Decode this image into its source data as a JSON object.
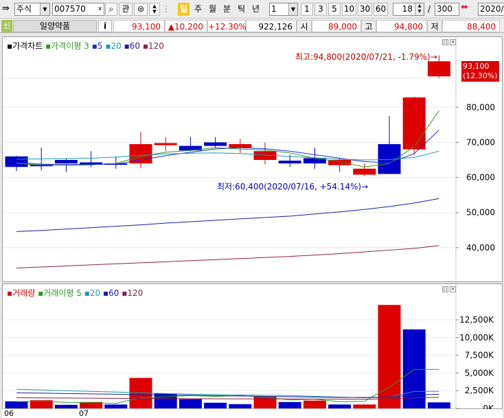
{
  "toolbar": {
    "market": "주식",
    "code": "007570",
    "watch_label": "관",
    "period_buttons": [
      "일",
      "주",
      "월",
      "분",
      "틱",
      "년"
    ],
    "interval_select": "1",
    "interval_buttons": [
      "1",
      "3",
      "5",
      "10",
      "30",
      "60"
    ],
    "page_current": "18",
    "page_sep": "/",
    "page_total": "300",
    "date": "2020/0"
  },
  "quote": {
    "badge": "신",
    "name": "일양약품",
    "info": "i",
    "price": "93,100",
    "change": "▲10,200",
    "change_pct": "+12.30%",
    "volume": "922,126",
    "open_label": "시",
    "open": "89,000",
    "high_label": "고",
    "high": "94,800",
    "low_label": "저",
    "low": "88,400"
  },
  "colors": {
    "up": "#dd0000",
    "down": "#0000c8",
    "ma_short": "#2e9a1e",
    "ma5": "#1a2ed6",
    "ma20": "#1f9ab0",
    "ma60": "#1c1ca8",
    "ma120": "#8a1f48"
  },
  "price_panel": {
    "legend_title": "가격차트",
    "legend_ma": "가격이평",
    "legend_periods": [
      "3",
      "5",
      "20",
      "60",
      "120"
    ],
    "high_note": "최고:94,800(2020/07/21, -1.79%)→",
    "low_note": "최저:60,400(2020/07/16, +54.14%)→",
    "current_price": "93,100",
    "current_pct": "(12.30%)"
  },
  "volume_panel": {
    "legend_title": "거래량",
    "legend_ma": "거래이평",
    "legend_periods": [
      "5",
      "20",
      "60",
      "120"
    ]
  },
  "x_labels": [
    "06",
    "07"
  ],
  "chart_data": [
    {
      "type": "candlestick",
      "title": "가격차트",
      "x": [
        "c1",
        "c2",
        "c3",
        "c4",
        "c5",
        "c6",
        "c7",
        "c8",
        "c9",
        "c10",
        "c11",
        "c12",
        "c13",
        "c14",
        "c15",
        "c16",
        "c17",
        "c18"
      ],
      "open": [
        66000,
        63700,
        65000,
        64300,
        64000,
        64000,
        69200,
        69000,
        70000,
        68500,
        65000,
        64800,
        65500,
        63500,
        60800,
        69500,
        68000,
        88800
      ],
      "high": [
        66200,
        68500,
        65500,
        67500,
        66000,
        73000,
        71500,
        71500,
        71500,
        71000,
        70000,
        66500,
        68500,
        65500,
        64000,
        77500,
        83000,
        94800
      ],
      "low": [
        61800,
        62000,
        61500,
        63000,
        62500,
        62800,
        67500,
        67500,
        68500,
        67000,
        63700,
        63000,
        62500,
        61500,
        60400,
        61000,
        66500,
        88400
      ],
      "close": [
        63000,
        63200,
        64000,
        63700,
        63800,
        69500,
        69800,
        67700,
        69000,
        69500,
        67500,
        64000,
        64000,
        65000,
        62500,
        61000,
        82800,
        93100
      ],
      "ylim": [
        30000,
        100000
      ],
      "yticks": [
        "40,000",
        "50,000",
        "60,000",
        "70,000",
        "80,000"
      ],
      "series": [
        {
          "name": "3",
          "values": [
            64000,
            63500,
            63400,
            63600,
            64000,
            66000,
            67200,
            67700,
            68500,
            68100,
            67800,
            67000,
            65500,
            64500,
            63000,
            64000,
            68800,
            79000
          ]
        },
        {
          "name": "5",
          "values": [
            64200,
            63800,
            63700,
            63700,
            63800,
            65000,
            66200,
            67200,
            68100,
            68500,
            68200,
            67500,
            66500,
            65500,
            64500,
            64200,
            66800,
            73500
          ]
        },
        {
          "name": "20",
          "values": [
            65200,
            65300,
            65400,
            65500,
            65800,
            66300,
            66700,
            66900,
            67000,
            66800,
            66400,
            66000,
            65600,
            65200,
            65000,
            65100,
            65700,
            67500
          ]
        },
        {
          "name": "60",
          "values": [
            44600,
            44900,
            45300,
            45700,
            46100,
            46500,
            47000,
            47400,
            47800,
            48200,
            48600,
            49000,
            49600,
            50200,
            50900,
            51700,
            52700,
            54000
          ]
        },
        {
          "name": "120",
          "values": [
            34200,
            34500,
            34800,
            35100,
            35400,
            35700,
            36000,
            36300,
            36600,
            36900,
            37200,
            37500,
            37900,
            38300,
            38800,
            39300,
            39800,
            40600
          ]
        }
      ]
    },
    {
      "type": "bar",
      "title": "거래량",
      "x": [
        "c1",
        "c2",
        "c3",
        "c4",
        "c5",
        "c6",
        "c7",
        "c8",
        "c9",
        "c10",
        "c11",
        "c12",
        "c13",
        "c14",
        "c15",
        "c16",
        "c17",
        "c18"
      ],
      "values": [
        1000,
        1150,
        500,
        900,
        550,
        4300,
        2100,
        1300,
        800,
        600,
        1700,
        900,
        1100,
        550,
        550,
        14600,
        11150,
        850
      ],
      "up": [
        false,
        true,
        false,
        true,
        false,
        true,
        false,
        false,
        false,
        false,
        true,
        false,
        true,
        false,
        true,
        true,
        false,
        false
      ],
      "ylim": [
        0,
        15500
      ],
      "yticks": [
        "0K",
        "2,500K",
        "5,000K",
        "7,500K",
        "10,000K",
        "12,500K"
      ],
      "series": [
        {
          "name": "5",
          "values": [
            950,
            1000,
            850,
            800,
            700,
            1500,
            1650,
            1800,
            1700,
            1800,
            1600,
            1200,
            1300,
            950,
            1000,
            3000,
            5500,
            5500
          ]
        },
        {
          "name": "20",
          "values": [
            2700,
            2600,
            2500,
            2400,
            2300,
            2200,
            2100,
            2000,
            1950,
            1900,
            1850,
            1800,
            1700,
            1600,
            1500,
            1600,
            2400,
            2400
          ]
        },
        {
          "name": "60",
          "values": [
            2200,
            2150,
            2100,
            2050,
            2000,
            1950,
            1900,
            1850,
            1800,
            1750,
            1700,
            1650,
            1600,
            1550,
            1550,
            1600,
            1900,
            2000
          ]
        },
        {
          "name": "120",
          "values": [
            1500,
            1480,
            1460,
            1440,
            1420,
            1400,
            1380,
            1370,
            1360,
            1350,
            1340,
            1330,
            1320,
            1310,
            1300,
            1350,
            1500,
            1550
          ]
        }
      ]
    }
  ]
}
